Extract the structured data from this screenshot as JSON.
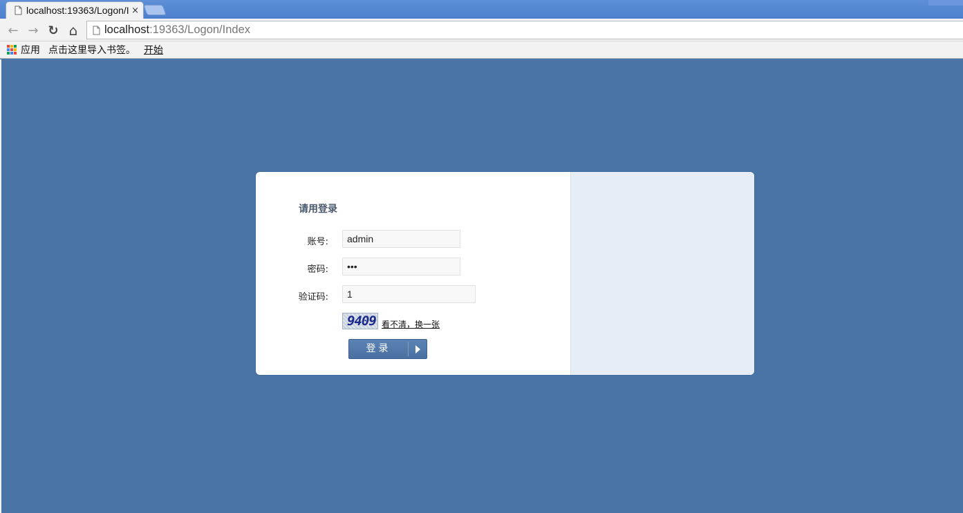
{
  "browser": {
    "tab_title": "localhost:19363/Logon/Index",
    "tab_close": "×",
    "url_host": "localhost",
    "url_rest": ":19363/Logon/Index",
    "nav": {
      "back": "←",
      "forward": "→",
      "reload": "↻",
      "home": "⌂"
    },
    "bookmarks": {
      "apps_label": "应用",
      "import_hint": "点击这里导入书签。",
      "start_link": "开始"
    }
  },
  "login": {
    "heading": "请用登录",
    "account_label": "账号:",
    "account_value": "admin",
    "password_label": "密码:",
    "password_value": "•••",
    "captcha_label": "验证码:",
    "captcha_value": "1",
    "captcha_image_text": "9409",
    "refresh_captcha": "看不清，换一张",
    "submit_label": "登录"
  },
  "colors": {
    "page_background": "#4a74a5",
    "card_right_panel": "#e6edf6",
    "button": "#4a70a0"
  }
}
